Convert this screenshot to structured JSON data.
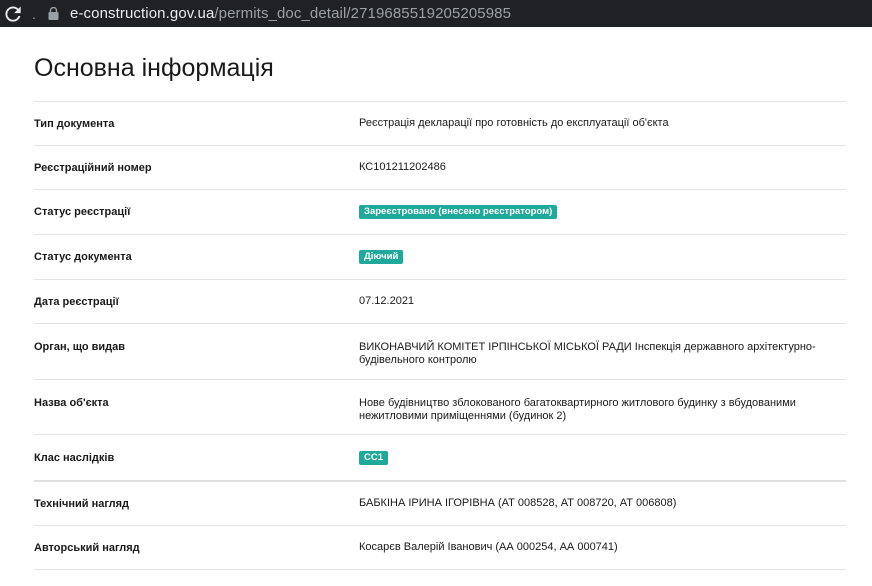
{
  "browser": {
    "url_host": "e-construction.gov.ua",
    "url_path": "/permits_doc_detail/2719685519205205985",
    "separator": "."
  },
  "page": {
    "title": "Основна інформація"
  },
  "rows": [
    {
      "label": "Тип документа",
      "value": "Реєстрація декларації про готовність до експлуатації об'єкта",
      "type": "text"
    },
    {
      "label": "Реєстраційний номер",
      "value": "КС101211202486",
      "type": "text"
    },
    {
      "label": "Статус реєстрації",
      "value": "Зареєстровано (внесено реєстратором)",
      "type": "badge"
    },
    {
      "label": "Статус документа",
      "value": "Діючий",
      "type": "badge"
    },
    {
      "label": "Дата реєстрації",
      "value": "07.12.2021",
      "type": "text"
    },
    {
      "label": "Орган, що видав",
      "value": "ВИКОНАВЧИЙ КОМІТЕТ ІРПІНСЬКОЇ МІСЬКОЇ РАДИ Інспекція державного архітектурно-будівельного контролю",
      "type": "text"
    },
    {
      "label": "Назва об'єкта",
      "value": "Нове будівництво зблокованого багатоквартирного житлового будинку з вбудованими нежитловими приміщеннями (будинок 2)",
      "type": "text"
    },
    {
      "label": "Клас наслідків",
      "value": "СС1",
      "type": "badge"
    },
    {
      "label": "Технічний нагляд",
      "value": "БАБКІНА ІРИНА ІГОРІВНА (АТ 008528, АТ 008720, АТ 006808)",
      "type": "text"
    },
    {
      "label": "Авторський нагляд",
      "value": "Косарєв Валерій Іванович (АА 000254, АА 000741)",
      "type": "text"
    }
  ],
  "colors": {
    "badge": "#1fa99a",
    "divider": "#e4e4e4",
    "topbar": "#202124"
  }
}
